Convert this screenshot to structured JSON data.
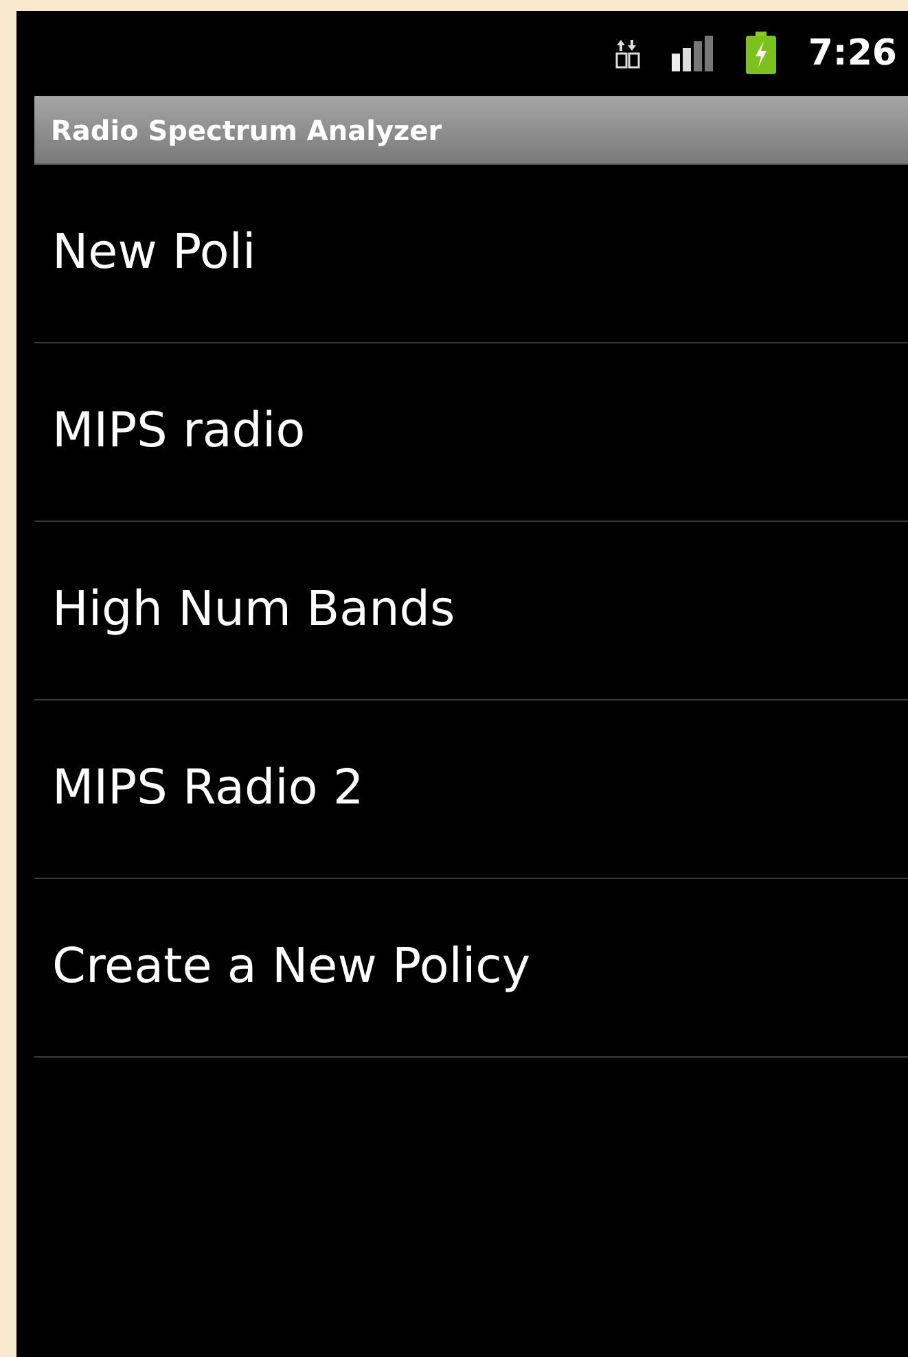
{
  "status_bar": {
    "time": "7:26"
  },
  "title_bar": {
    "title": "Radio Spectrum Analyzer"
  },
  "list": {
    "items": [
      {
        "label": "New Poli"
      },
      {
        "label": "MIPS radio"
      },
      {
        "label": "High Num Bands"
      },
      {
        "label": "MIPS Radio 2"
      },
      {
        "label": "Create a New Policy"
      }
    ]
  }
}
